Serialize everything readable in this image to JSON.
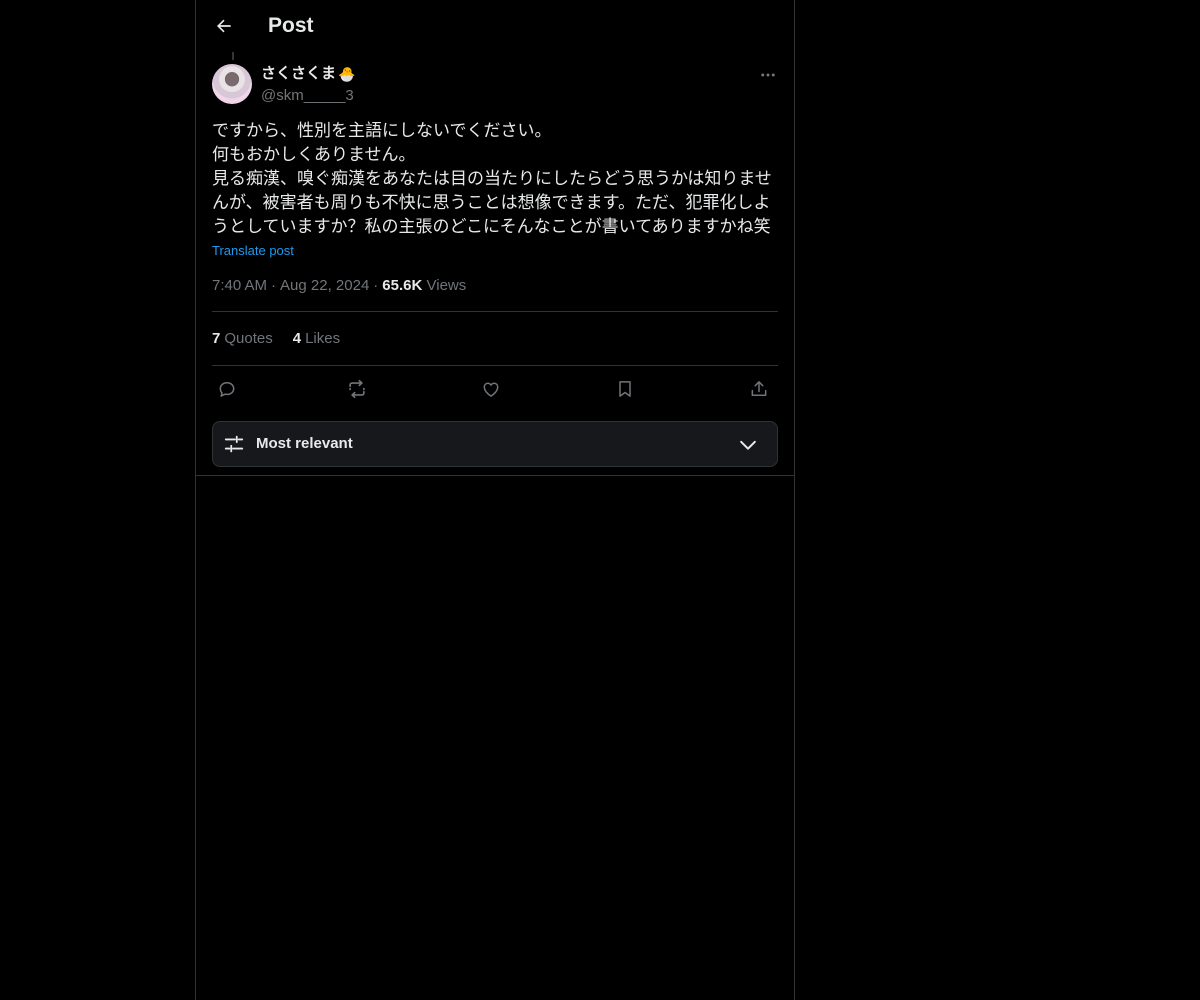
{
  "header": {
    "title": "Post"
  },
  "post": {
    "display_name": "さくさくま",
    "name_emoji": "🐣",
    "handle": "@skm_____3",
    "text": "ですから、性別を主語にしないでください。\n何もおかしくありません。\n見る痴漢、嗅ぐ痴漢をあなたは目の当たりにしたらどう思うかは知りませんが、被害者も周りも不快に思うことは想像できます。ただ、犯罪化しようとしていますか？私の主張のどこにそんなことが書いてありますかね笑",
    "translate_label": "Translate post",
    "time": "7:40 AM",
    "date": "Aug 22, 2024",
    "views_count": "65.6K",
    "views_label": "Views",
    "separator": "·"
  },
  "stats": {
    "quotes_count": "7",
    "quotes_label": "Quotes",
    "likes_count": "4",
    "likes_label": "Likes"
  },
  "sort": {
    "label": "Most relevant"
  },
  "colors": {
    "background": "#000000",
    "text_primary": "#e7e9ea",
    "text_secondary": "#71767b",
    "accent": "#1d9bf0",
    "border": "#2f3336"
  }
}
